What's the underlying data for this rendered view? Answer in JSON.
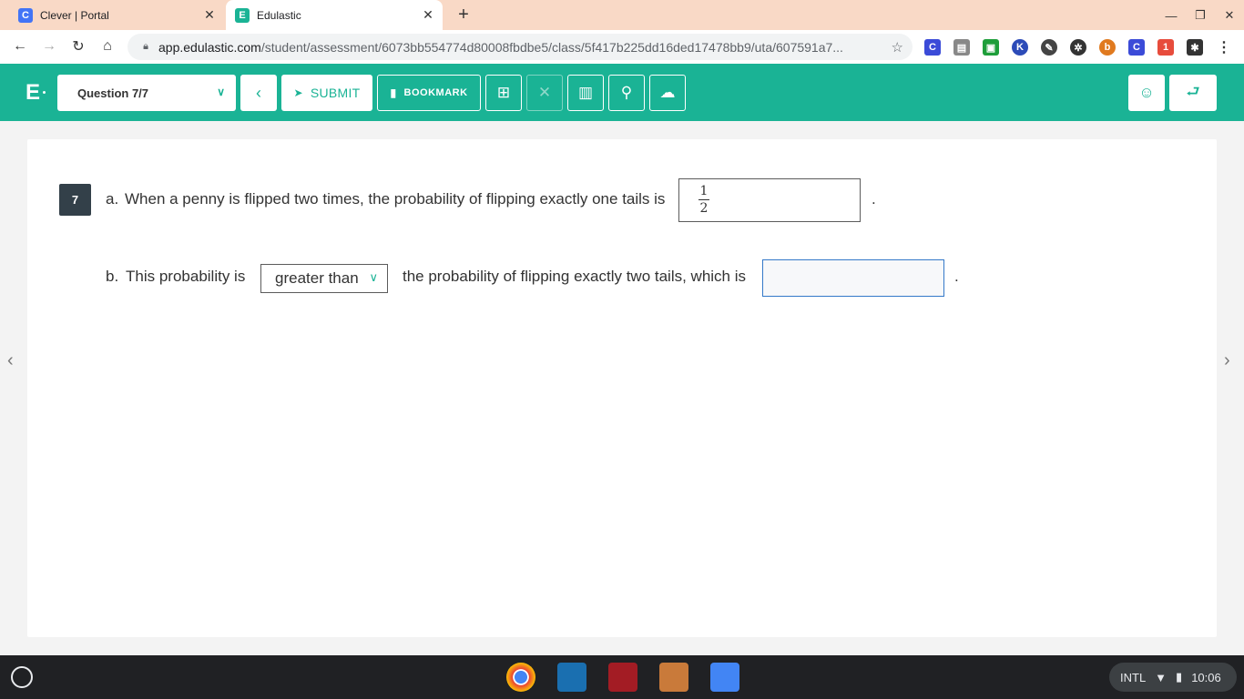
{
  "browser": {
    "tabs": [
      {
        "title": "Clever | Portal",
        "favicon": "C"
      },
      {
        "title": "Edulastic",
        "favicon": "E"
      }
    ],
    "url_host": "app.edulastic.com",
    "url_path": "/student/assessment/6073bb554774d80008fbdbe5/class/5f417b225dd16ded17478bb9/uta/607591a7..."
  },
  "header": {
    "question_select": "Question 7/7",
    "submit_label": "SUBMIT",
    "bookmark_label": "BOOKMARK"
  },
  "question": {
    "number": "7",
    "part_a_prefix": "a.",
    "part_a_text": "When a penny is flipped two times, the probability of flipping exactly one tails is",
    "answer_a": {
      "numerator": "1",
      "denominator": "2"
    },
    "part_b_prefix": "b.",
    "part_b_text1": "This probability is",
    "dropdown_value": "greater than",
    "part_b_text2": "the probability of flipping exactly two tails, which is",
    "answer_b": "",
    "period": "."
  },
  "shelf": {
    "input_method": "INTL",
    "time": "10:06"
  },
  "colors": {
    "brand": "#1ab395",
    "qbadge": "#334049",
    "input_focus": "#3479c9"
  }
}
